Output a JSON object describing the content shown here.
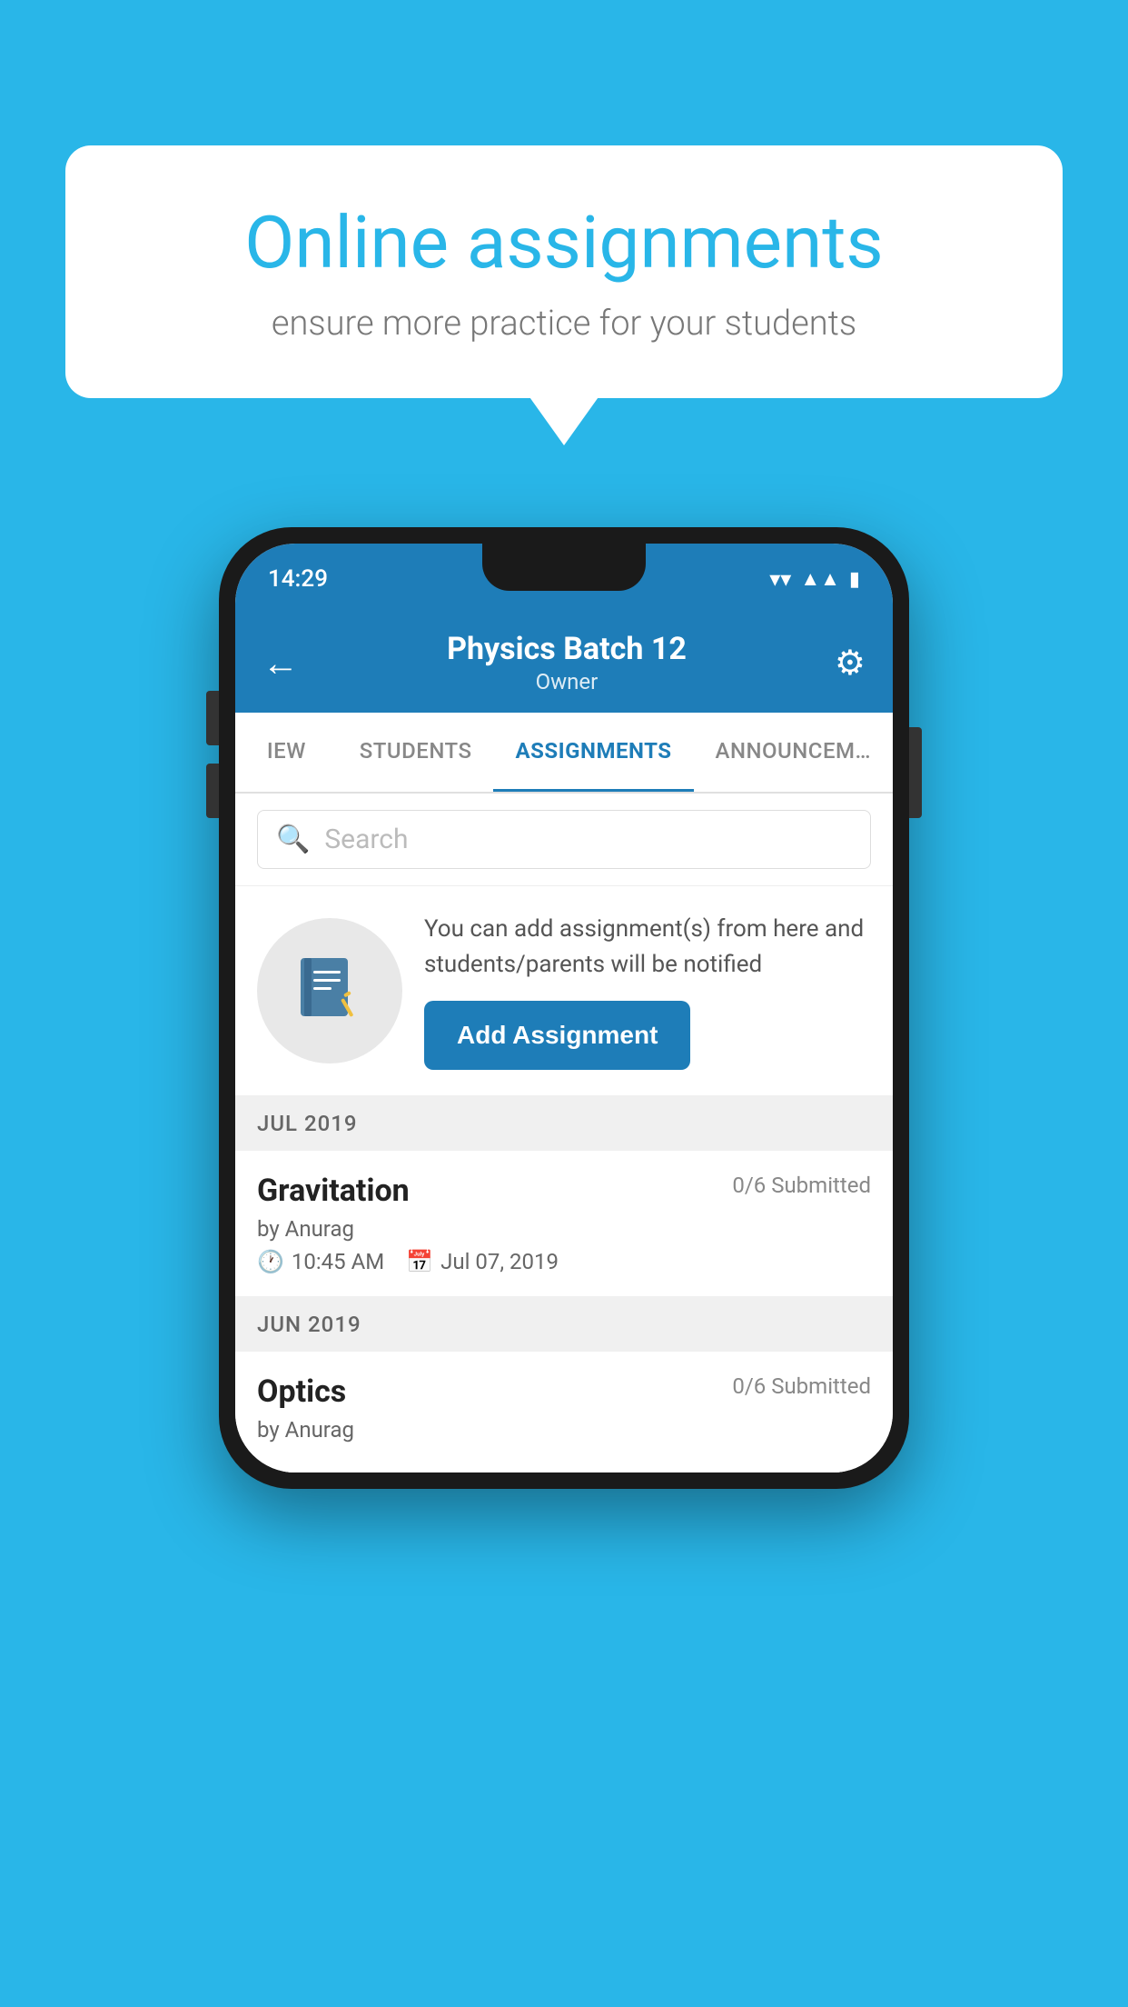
{
  "background_color": "#29b6e8",
  "speech_bubble": {
    "title": "Online assignments",
    "subtitle": "ensure more practice for your students"
  },
  "phone": {
    "status_bar": {
      "time": "14:29"
    },
    "header": {
      "title": "Physics Batch 12",
      "subtitle": "Owner",
      "back_label": "←",
      "settings_label": "⚙"
    },
    "tabs": [
      {
        "label": "IEW",
        "active": false
      },
      {
        "label": "STUDENTS",
        "active": false
      },
      {
        "label": "ASSIGNMENTS",
        "active": true
      },
      {
        "label": "ANNOUNCEM…",
        "active": false
      }
    ],
    "search": {
      "placeholder": "Search"
    },
    "promo": {
      "text": "You can add assignment(s) from here and students/parents will be notified",
      "button_label": "Add Assignment"
    },
    "sections": [
      {
        "month_label": "JUL 2019",
        "assignments": [
          {
            "title": "Gravitation",
            "submitted": "0/6 Submitted",
            "by": "by Anurag",
            "time": "10:45 AM",
            "date": "Jul 07, 2019"
          }
        ]
      },
      {
        "month_label": "JUN 2019",
        "assignments": [
          {
            "title": "Optics",
            "submitted": "0/6 Submitted",
            "by": "by Anurag",
            "time": "",
            "date": ""
          }
        ]
      }
    ]
  }
}
